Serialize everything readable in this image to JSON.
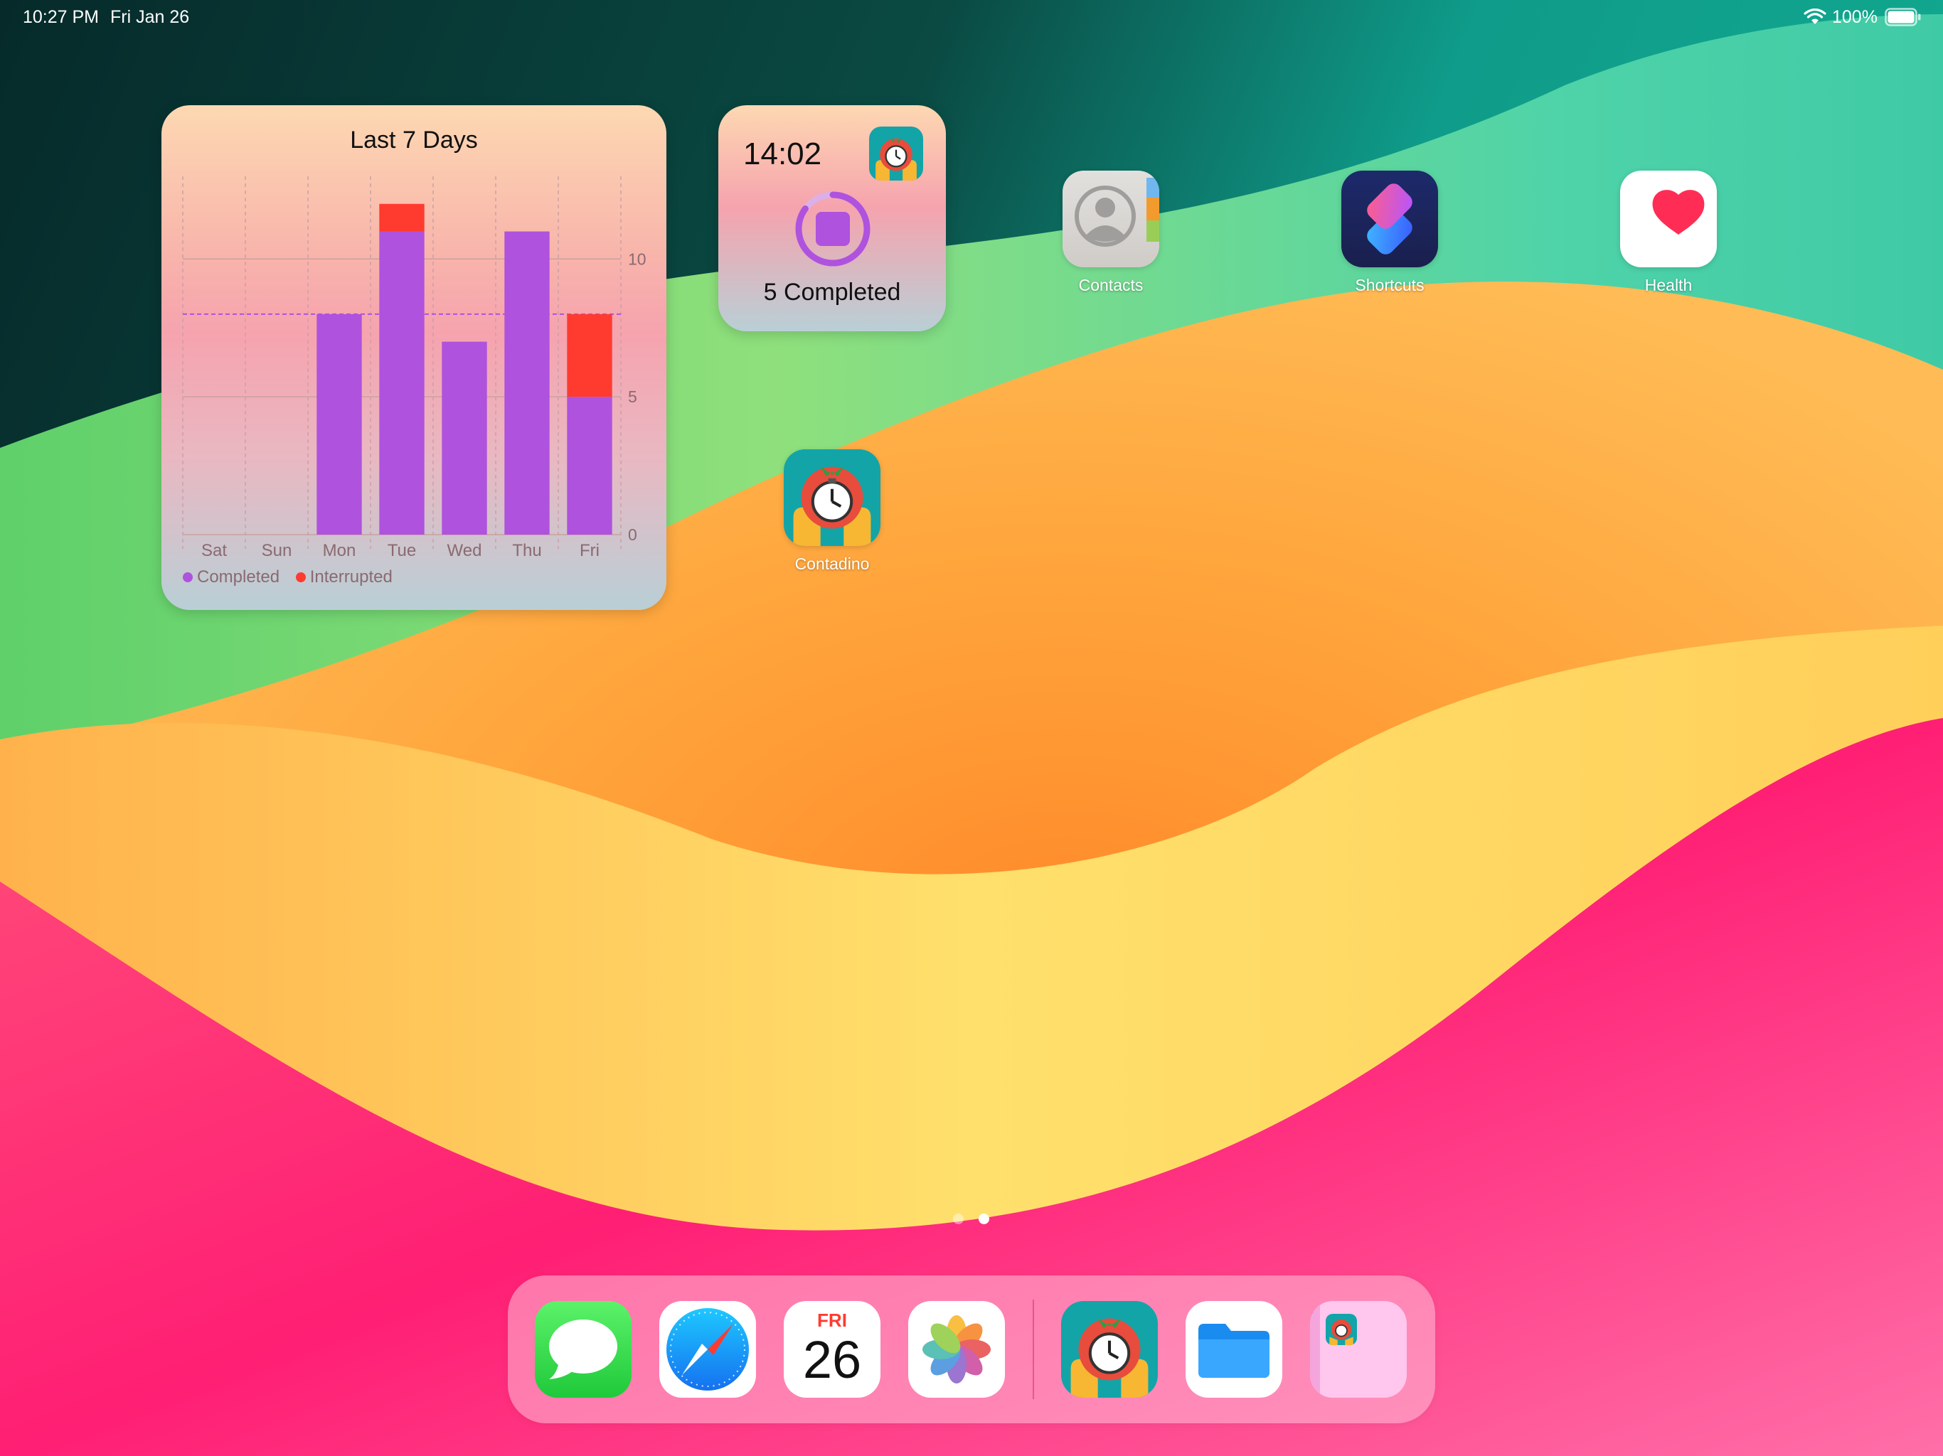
{
  "status_bar": {
    "time": "10:27 PM",
    "date": "Fri Jan 26",
    "battery": "100%"
  },
  "chart_widget": {
    "chart_data": {
      "type": "bar",
      "stacked": true,
      "title": "Last 7 Days",
      "categories": [
        "Sat",
        "Sun",
        "Mon",
        "Tue",
        "Wed",
        "Thu",
        "Fri"
      ],
      "series": [
        {
          "name": "Completed",
          "values": [
            0,
            0,
            8,
            11,
            7,
            11,
            5
          ],
          "color": "#AF52DE"
        },
        {
          "name": "Interrupted",
          "values": [
            0,
            0,
            0,
            1,
            0,
            0,
            3
          ],
          "color": "#FF3B30"
        }
      ],
      "y_ticks": [
        "0",
        "5",
        "10"
      ],
      "ylim": [
        0,
        13
      ],
      "goal_line": 8,
      "grid": true,
      "legend_position": "bottom-left"
    }
  },
  "timer_widget": {
    "time": "14:02",
    "status": "5 Completed",
    "progress_fraction": 0.85
  },
  "apps": {
    "contacts": "Contacts",
    "shortcuts": "Shortcuts",
    "health": "Health",
    "contadino": "Contadino"
  },
  "dock": {
    "calendar_day": "FRI",
    "calendar_date": "26",
    "icons": [
      "messages-icon",
      "safari-icon",
      "calendar-icon",
      "photos-icon",
      "contadino-icon",
      "files-icon",
      "recent-folder-icon"
    ]
  },
  "page_indicator": {
    "pages": 2,
    "current": 1
  },
  "colors": {
    "completed": "#AF52DE",
    "interrupted": "#FF3B30",
    "teal_icon": "#13A4A8"
  }
}
